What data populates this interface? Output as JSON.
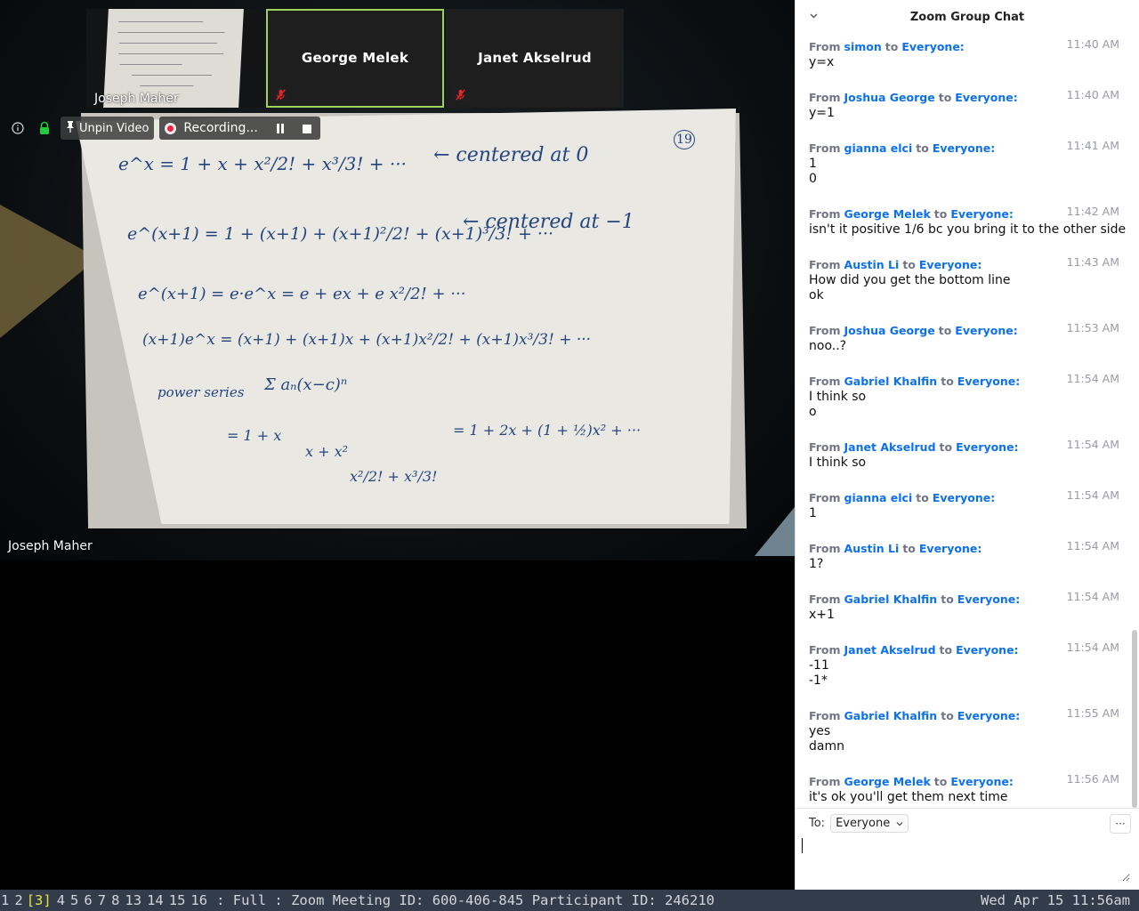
{
  "thumbnails": [
    {
      "name": "Joseph Maher",
      "type": "video"
    },
    {
      "name": "George Melek",
      "type": "avatar",
      "muted": true,
      "active_speaker": true
    },
    {
      "name": "Janet Akselrud",
      "type": "avatar",
      "muted": true
    }
  ],
  "toolbar": {
    "unpin_label": "Unpin Video",
    "recording_label": "Recording..."
  },
  "main_video": {
    "name": "Joseph Maher"
  },
  "whiteboard": {
    "page_number": "19",
    "lines": [
      "e^x = 1 + x + x²/2! + x³/3! + ···",
      "← centered at 0",
      "e^(x+1) = 1 + (x+1) + (x+1)²/2! + (x+1)³/3! + ···",
      "← centered at −1",
      "e^(x+1) = e·e^x = e + ex + e x²/2! + ···",
      "(x+1)e^x = (x+1) + (x+1)x + (x+1)x²/2! + (x+1)x³/3! + ···",
      "power series",
      "Σ aₙ(x−c)ⁿ",
      "= 1 + x",
      "x + x²",
      "x²/2! + x³/3!",
      "= 1 + 2x + (1 + ½)x² + ···"
    ]
  },
  "chat": {
    "title": "Zoom Group Chat",
    "from_word": "From",
    "to_word": "to",
    "to_label": "To:",
    "recipient": "Everyone",
    "more_label": "···",
    "messages": [
      {
        "sender": "simon",
        "to": "Everyone:",
        "time": "11:40 AM",
        "text": "y=x"
      },
      {
        "sender": "Joshua George",
        "to": "Everyone:",
        "time": "11:40 AM",
        "text": "y=1"
      },
      {
        "sender": "gianna elci",
        "to": "Everyone:",
        "time": "11:41 AM",
        "text": "1\n0"
      },
      {
        "sender": "George Melek",
        "to": "Everyone:",
        "time": "11:42 AM",
        "text": "isn't it positive 1/6 bc you bring it to the other side"
      },
      {
        "sender": "Austin Li",
        "to": "Everyone:",
        "time": "11:43 AM",
        "text": "How did you get the bottom line\nok"
      },
      {
        "sender": "Joshua George",
        "to": "Everyone:",
        "time": "11:53 AM",
        "text": "noo..?"
      },
      {
        "sender": "Gabriel Khalfin",
        "to": "Everyone:",
        "time": "11:54 AM",
        "text": "I think so\no"
      },
      {
        "sender": "Janet Akselrud",
        "to": "Everyone:",
        "time": "11:54 AM",
        "text": "I think so"
      },
      {
        "sender": "gianna elci",
        "to": "Everyone:",
        "time": "11:54 AM",
        "text": "1"
      },
      {
        "sender": "Austin Li",
        "to": "Everyone:",
        "time": "11:54 AM",
        "text": "1?"
      },
      {
        "sender": "Gabriel Khalfin",
        "to": "Everyone:",
        "time": "11:54 AM",
        "text": "x+1"
      },
      {
        "sender": "Janet Akselrud",
        "to": "Everyone:",
        "time": "11:54 AM",
        "text": "-11\n-1*"
      },
      {
        "sender": "Gabriel Khalfin",
        "to": "Everyone:",
        "time": "11:55 AM",
        "text": "yes\ndamn"
      },
      {
        "sender": "George Melek",
        "to": "Everyone:",
        "time": "11:56 AM",
        "text": "it's ok you'll get them next time"
      }
    ]
  },
  "statusbar": {
    "workspaces": [
      "1",
      "2",
      "3",
      "4",
      "5",
      "6",
      "7",
      "8",
      "13",
      "14",
      "15",
      "16"
    ],
    "active_workspace": "3",
    "info": ": Full : Zoom Meeting ID: 600-406-845 Participant ID: 246210",
    "clock": "Wed Apr 15 11:56am"
  },
  "colors": {
    "accent": "#0e71eb",
    "speaker_border": "#9dd35a",
    "mute": "#e02828",
    "statusbar_bg": "#333c4a",
    "active_workspace": "#e9e33c"
  }
}
